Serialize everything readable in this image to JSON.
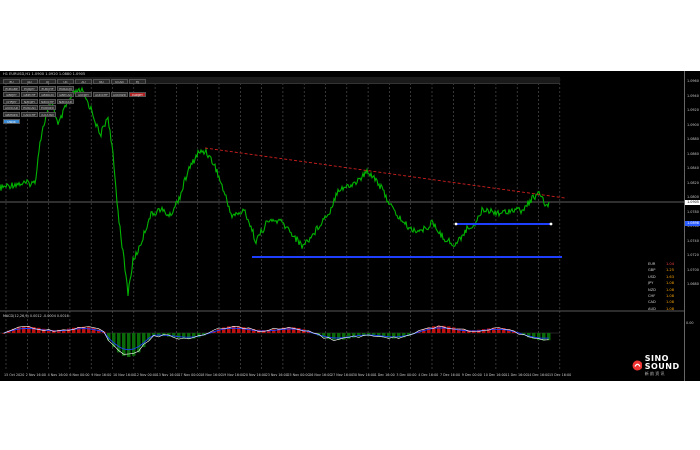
{
  "window": {
    "chart_caption": "H1 EURUSD,H1 1.0900 1.0920 1.0880 1.0905"
  },
  "symbol_buttons": [
    {
      "label": "EU",
      "state": "normal"
    },
    {
      "label": "GU",
      "state": "normal"
    },
    {
      "label": "UJ",
      "state": "normal"
    },
    {
      "label": "UC",
      "state": "normal"
    },
    {
      "label": "AU",
      "state": "normal"
    },
    {
      "label": "NU",
      "state": "normal"
    },
    {
      "label": "UCAD",
      "state": "normal"
    },
    {
      "label": "EJ",
      "state": "normal"
    },
    {
      "label": "EURGBP",
      "state": "normal"
    },
    {
      "label": "EURJPY",
      "state": "normal"
    },
    {
      "label": "EURCHF",
      "state": "normal"
    },
    {
      "label": "EURAUD",
      "state": "normal"
    },
    {
      "label": "GBPJPY",
      "state": "normal"
    },
    {
      "label": "GBPCHF",
      "state": "normal"
    },
    {
      "label": "GBPAUD",
      "state": "normal"
    },
    {
      "label": "GBPCAD",
      "state": "normal"
    },
    {
      "label": "AUDJPY",
      "state": "normal"
    },
    {
      "label": "AUDCHF",
      "state": "normal"
    },
    {
      "label": "AUDNZD",
      "state": "normal"
    },
    {
      "label": "CADJPY",
      "state": "alert"
    },
    {
      "label": "CHFJPY",
      "state": "normal"
    },
    {
      "label": "NZDJPY",
      "state": "normal"
    },
    {
      "label": "NZDCHF",
      "state": "normal"
    },
    {
      "label": "NZDCAD",
      "state": "normal"
    },
    {
      "label": "AUDCAD",
      "state": "normal"
    },
    {
      "label": "EURCAD",
      "state": "normal"
    },
    {
      "label": "EURNZD",
      "state": "normal"
    },
    {
      "label": "GBPNZD",
      "state": "normal"
    },
    {
      "label": "CADCHF",
      "state": "normal"
    },
    {
      "label": "XAUUSD",
      "state": "normal"
    },
    {
      "label": "USDX",
      "state": "active"
    }
  ],
  "price_scale": {
    "ticks": [
      "1.0960",
      "1.0940",
      "1.0920",
      "1.0900",
      "1.0880",
      "1.0860",
      "1.0840",
      "1.0820",
      "1.0800",
      "1.0780",
      "1.0760",
      "1.0740",
      "1.0720",
      "1.0700",
      "1.0680"
    ],
    "current_price": "1.0905",
    "current_price_color": "#ffffff",
    "line_price": "1.0898",
    "line_price_color": "#2b5cff"
  },
  "time_axis": [
    "15 Oct 2020",
    "2 Nov 16:00",
    "4 Nov 16:00",
    "6 Nov 00:00",
    "9 Nov 16:00",
    "10 Nov 16:00",
    "12 Nov 00:00",
    "13 Nov 16:00",
    "17 Nov 00:00",
    "18 Nov 16:00",
    "19 Nov 16:00",
    "20 Nov 16:00",
    "23 Nov 16:00",
    "25 Nov 00:00",
    "26 Nov 16:00",
    "27 Nov 16:00",
    "30 Nov 16:00",
    "1 Dec 16:00",
    "3 Dec 00:00",
    "4 Dec 16:00",
    "7 Dec 16:00",
    "9 Dec 00:00",
    "10 Dec 16:00",
    "11 Dec 16:00",
    "14 Dec 16:00",
    "15 Dec 16:00"
  ],
  "currency_strength": [
    {
      "name": "EUR",
      "value": "1.04",
      "color": "#ff4040"
    },
    {
      "name": "GBP",
      "value": "1.25",
      "color": "#ffa500"
    },
    {
      "name": "USD",
      "value": "1.63",
      "color": "#ffa500"
    },
    {
      "name": "JPY",
      "value": "1.08",
      "color": "#ffa500"
    },
    {
      "name": "NZD",
      "value": "1.08",
      "color": "#ffa500"
    },
    {
      "name": "CHF",
      "value": "1.08",
      "color": "#ffa500"
    },
    {
      "name": "CAD",
      "value": "1.08",
      "color": "#ffa500"
    },
    {
      "name": "AUD",
      "value": "1.08",
      "color": "#ffa500"
    }
  ],
  "oscillator": {
    "caption": "MACD(12,26,9) 0.0012 -0.0004 0.0016",
    "scale": "0.00"
  },
  "brand": {
    "name": "SINO SOUND",
    "sub": "新 韵 资 讯"
  },
  "colors": {
    "price_line": "#00b400",
    "resistance": "#d02020",
    "support": "#1f3fff",
    "grid": "#5a5a5a",
    "osc_pos": "#c01010",
    "osc_neg": "#0a6a0a",
    "osc_fast": "#ffffff",
    "osc_slow": "#2040ff"
  }
}
